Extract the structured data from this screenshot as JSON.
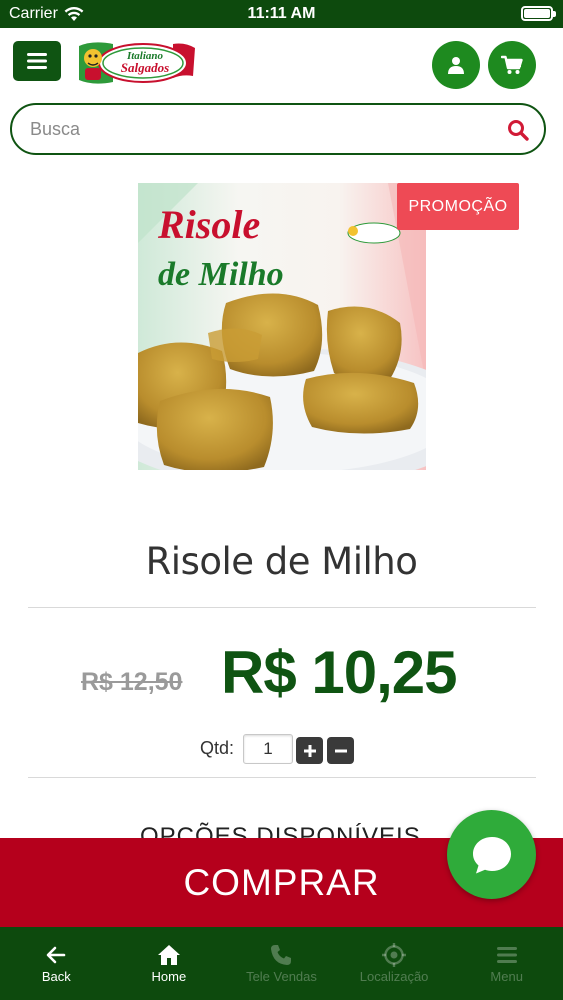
{
  "status_bar": {
    "carrier": "Carrier",
    "time": "11:11 AM"
  },
  "header": {
    "menu_icon": "hamburger-icon",
    "logo_alt": "Italiano Salgados",
    "user_icon": "user-icon",
    "cart_icon": "cart-icon"
  },
  "search": {
    "placeholder": "Busca",
    "value": ""
  },
  "product": {
    "image_text_line1": "Risole",
    "image_text_line2": "de Milho",
    "badge": "PROMOÇÃO",
    "name": "Risole de Milho",
    "old_price": "R$ 12,50",
    "price": "R$ 10,25",
    "qty_label": "Qtd:",
    "qty_value": "1",
    "options_title": "OPÇÕES DISPONÍVEIS"
  },
  "buy_button": "COMPRAR",
  "tabs": [
    {
      "label": "Back",
      "icon": "arrow-left-icon"
    },
    {
      "label": "Home",
      "icon": "home-icon"
    },
    {
      "label": "Tele Vendas",
      "icon": "phone-icon"
    },
    {
      "label": "Localização",
      "icon": "location-icon"
    },
    {
      "label": "Menu",
      "icon": "menu-icon"
    }
  ],
  "colors": {
    "brand_green": "#0f5412",
    "button_green": "#1e8a1f",
    "buy_red": "#b5001c",
    "promo_red": "#ee4a55",
    "chat_green": "#2fab3a"
  }
}
